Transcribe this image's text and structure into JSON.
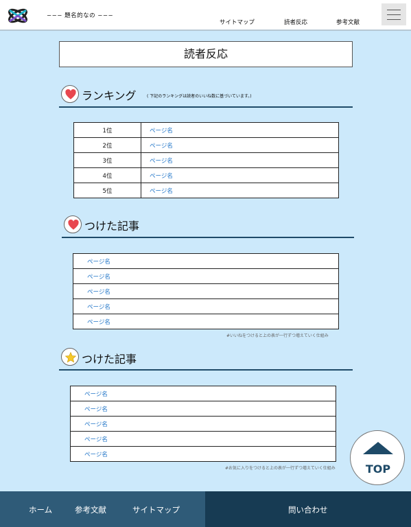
{
  "header": {
    "site_title": "−−− 題名的なの −−−",
    "nav": [
      "サイトマップ",
      "読者反応",
      "参考文献"
    ]
  },
  "page_title": "読者反応",
  "ranking": {
    "title": "ランキング",
    "note": "( 下記のランキングは読者のいいね数に基づいています。)",
    "rows": [
      {
        "rank": "1位",
        "page": "ページ名"
      },
      {
        "rank": "2位",
        "page": "ページ名"
      },
      {
        "rank": "3位",
        "page": "ページ名"
      },
      {
        "rank": "4位",
        "page": "ページ名"
      },
      {
        "rank": "5位",
        "page": "ページ名"
      }
    ]
  },
  "liked": {
    "title": "つけた記事",
    "rows": [
      "ページ名",
      "ページ名",
      "ページ名",
      "ページ名",
      "ページ名"
    ],
    "footnote": "#いいねをつけると上の表が一行ずつ増えていく仕組み"
  },
  "favorites": {
    "title": "つけた記事",
    "rows": [
      "ページ名",
      "ページ名",
      "ページ名",
      "ページ名",
      "ページ名"
    ],
    "footnote": "#お気に入りをつけると上の表が一行ずつ増えていく仕組み"
  },
  "top_button": "TOP",
  "footer": {
    "links": [
      "ホーム",
      "参考文献",
      "サイトマップ"
    ],
    "contact": "問い合わせ"
  },
  "colors": {
    "background": "#cce9fb",
    "accent": "#1e4a68",
    "link": "#1d73c7",
    "heart": "#e8474f",
    "star": "#f6c829"
  }
}
